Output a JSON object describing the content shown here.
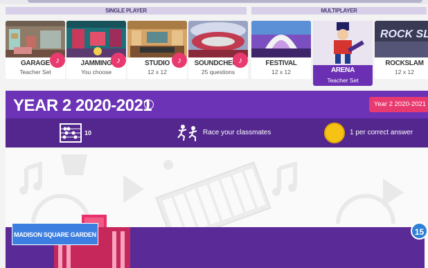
{
  "sections": {
    "single_player": "SINGLE PLAYER",
    "multiplayer": "MULTIPLAYER"
  },
  "game_modes": [
    {
      "name": "GARAGE",
      "sub": "Teacher Set"
    },
    {
      "name": "JAMMING",
      "sub": "You choose"
    },
    {
      "name": "STUDIO",
      "sub": "12 x 12"
    },
    {
      "name": "SOUNDCHECK",
      "sub": "25 questions"
    },
    {
      "name": "FESTIVAL",
      "sub": "12 x 12"
    },
    {
      "name": "ARENA",
      "sub": "Teacher Set"
    },
    {
      "name": "ROCKSLAM",
      "sub": "12 x 12"
    }
  ],
  "panel": {
    "title": "YEAR 2 2020-2021",
    "badge": "Year 2 2020-2021"
  },
  "stats": {
    "rounds": "10",
    "race": "Race your classmates",
    "coins": "1 per correct answer"
  },
  "venue": {
    "label": "MADISON SQUARE GARDEN",
    "count": "15"
  },
  "colors": {
    "purple": "#6c33b6",
    "dark_purple": "#53278e",
    "pink": "#e93a6f",
    "blue": "#3d7fe0"
  },
  "icons": {
    "guitar": "guitar-icon",
    "info": "info-icon",
    "abacus": "abacus-icon",
    "race": "race-icon",
    "coin": "coin-icon"
  }
}
